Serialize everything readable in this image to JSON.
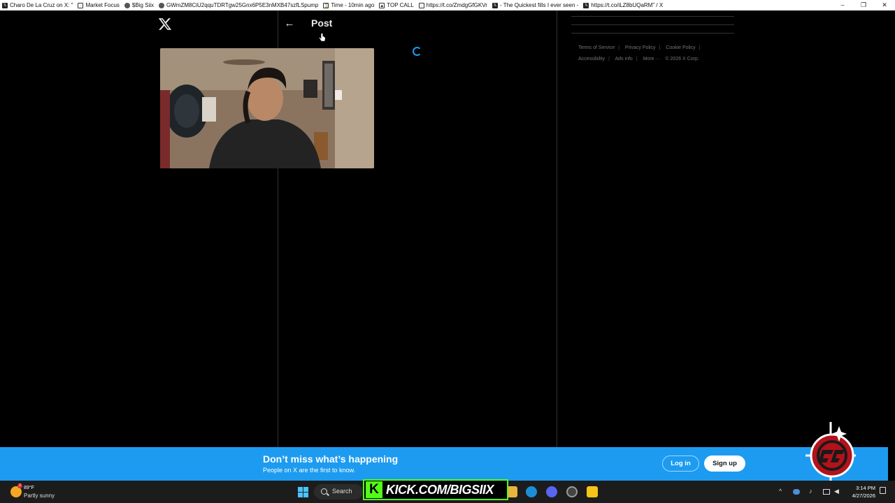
{
  "browser": {
    "tabs": [
      {
        "label": "Charo De La Cruz on X: \"",
        "icon": "x-icon"
      },
      {
        "label": "Market Focus",
        "icon": "page-icon"
      },
      {
        "label": "$Big Siix",
        "icon": "page-icon"
      },
      {
        "label": "GWmZM8CiU2qquTDRTgw25Gnx6P5E3nMXB47szfLSpump",
        "icon": "page-icon"
      },
      {
        "label": "Time - 10min ago",
        "icon": "hourglass-icon"
      },
      {
        "label": "TOP CALL",
        "icon": "page-icon"
      },
      {
        "label": "https://t.co/ZmdgGfGKVr",
        "icon": "page-icon"
      },
      {
        "label": "- The Quickest fills I ever seen -",
        "icon": "x-icon"
      },
      {
        "label": "https://t.co/iLZ8bUQaRM\" / X",
        "icon": "x-icon"
      }
    ],
    "window_controls": [
      "–",
      "❐",
      "✕"
    ]
  },
  "page": {
    "header_title": "Post",
    "back_icon": "←",
    "footer_links": [
      "Terms of Service",
      "Privacy Policy",
      "Cookie Policy",
      "Accessibility",
      "Ads info",
      "More ···",
      "© 2026 X Corp."
    ]
  },
  "banner": {
    "title": "Don’t miss what’s happening",
    "subtitle": "People on X are the first to know.",
    "login_label": "Log in",
    "signup_label": "Sign up"
  },
  "taskbar": {
    "weather_temp": "89°F",
    "weather_desc": "Partly sunny",
    "weather_badge": "2",
    "search_label": "Search",
    "kick_text": "KICK.COM/BIGSIIX",
    "kick_letter": "K",
    "clock_time": "3:14 PM",
    "clock_date": "4/27/2026"
  },
  "colors": {
    "accent": "#1d9bf0",
    "background": "#000000",
    "kick_green": "#53fc18"
  }
}
